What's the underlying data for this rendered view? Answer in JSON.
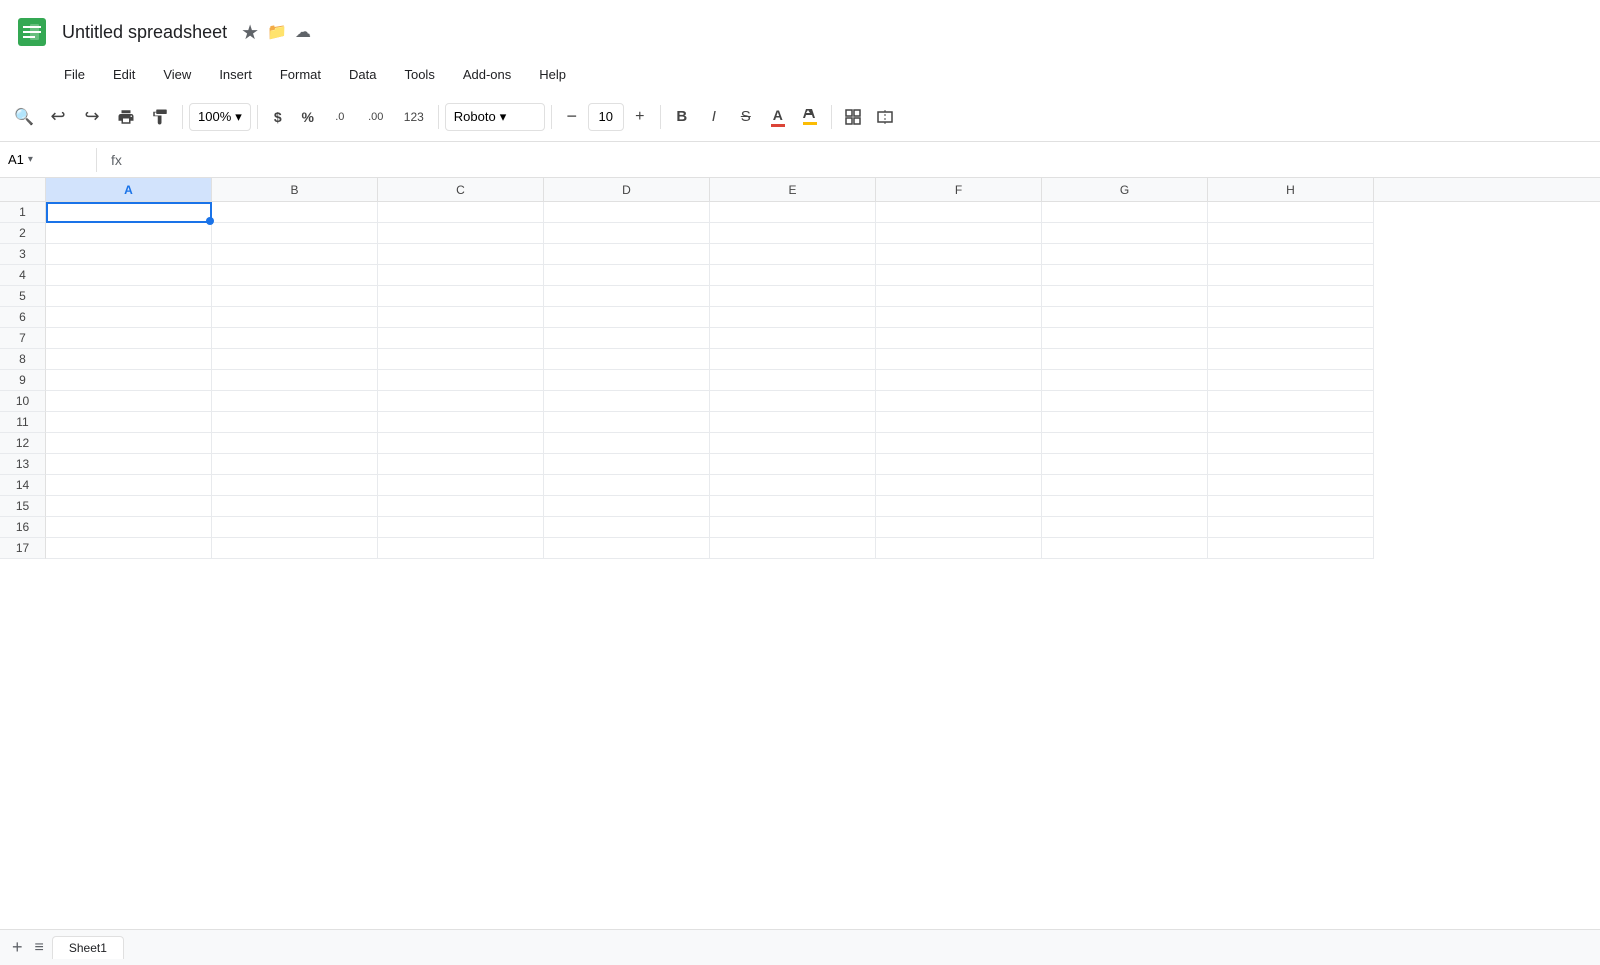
{
  "app": {
    "icon_color": "#34a853",
    "title": "Untitled spreadsheet",
    "star_icon": "★",
    "folder_icon": "📁",
    "cloud_icon": "☁"
  },
  "menu": {
    "items": [
      "File",
      "Edit",
      "View",
      "Insert",
      "Format",
      "Data",
      "Tools",
      "Add-ons",
      "Help"
    ]
  },
  "toolbar": {
    "zoom_value": "100%",
    "zoom_dropdown_icon": "▾",
    "font_name": "Roboto",
    "font_dropdown_icon": "▾",
    "font_size": "10",
    "search_icon": "🔍",
    "undo_icon": "↩",
    "redo_icon": "↪",
    "print_icon": "🖨",
    "paintformat_icon": "🎨",
    "currency_icon": "$",
    "percent_icon": "%",
    "decimal_decrease_icon": ".0",
    "decimal_increase_icon": ".00",
    "format_123_icon": "123",
    "font_size_decrease_icon": "−",
    "font_size_increase_icon": "+",
    "bold_icon": "B",
    "italic_icon": "I",
    "strikethrough_icon": "S̶",
    "text_color_icon": "A",
    "fill_color_icon": "◧",
    "borders_icon": "⊞",
    "merge_icon": "⊟"
  },
  "formula_bar": {
    "cell_ref": "A1",
    "dropdown_icon": "▾",
    "fx_label": "fx"
  },
  "grid": {
    "columns": [
      "A",
      "B",
      "C",
      "D",
      "E",
      "F",
      "G",
      "H"
    ],
    "rows": [
      1,
      2,
      3,
      4,
      5,
      6,
      7,
      8,
      9,
      10,
      11,
      12,
      13,
      14,
      15,
      16,
      17
    ],
    "active_cell": "A1"
  },
  "sheets": {
    "tabs": [
      "Sheet1"
    ],
    "add_label": "+"
  }
}
